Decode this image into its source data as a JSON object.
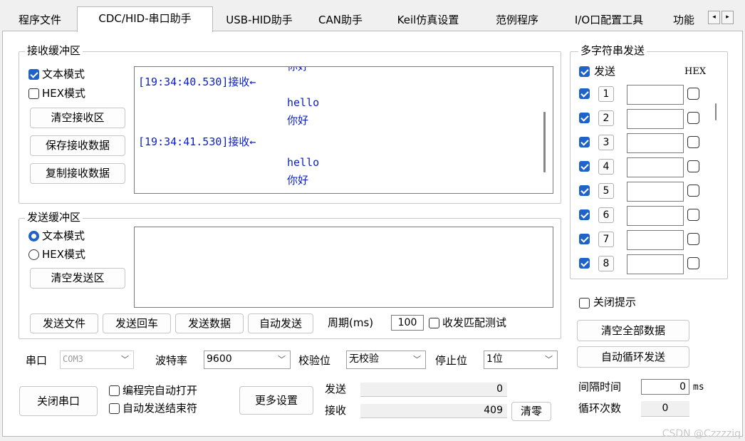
{
  "tabs": [
    {
      "label": "程序文件"
    },
    {
      "label": "CDC/HID-串口助手",
      "active": true
    },
    {
      "label": "USB-HID助手"
    },
    {
      "label": "CAN助手"
    },
    {
      "label": "Keil仿真设置"
    },
    {
      "label": "范例程序"
    },
    {
      "label": "I/O口配置工具"
    },
    {
      "label": "功能"
    }
  ],
  "tab_scroll": {
    "left": "◂",
    "right": "▸"
  },
  "receive": {
    "legend": "接收缓冲区",
    "text_mode": {
      "label": "文本模式",
      "checked": true
    },
    "hex_mode": {
      "label": "HEX模式",
      "checked": false
    },
    "clear_label": "清空接收区",
    "save_label": "保存接收数据",
    "copy_label": "复制接收数据",
    "lines": [
      {
        "text": "你好",
        "indent": 2
      },
      {
        "text": "[19:34:40.530]接收←",
        "indent": 0
      },
      {
        "text": "hello",
        "indent": 2
      },
      {
        "text": "你好",
        "indent": 2
      },
      {
        "text": "[19:34:41.530]接收←",
        "indent": 0
      },
      {
        "text": "hello",
        "indent": 2
      },
      {
        "text": "你好",
        "indent": 2
      }
    ]
  },
  "send": {
    "legend": "发送缓冲区",
    "text_mode": {
      "label": "文本模式",
      "selected": true
    },
    "hex_mode": {
      "label": "HEX模式",
      "selected": false
    },
    "clear_label": "清空发送区",
    "send_file_label": "发送文件",
    "send_enter_label": "发送回车",
    "send_data_label": "发送数据",
    "auto_send_label": "自动发送",
    "period_label": "周期(ms)",
    "period_value": "100",
    "match_test_label": "收发匹配测试"
  },
  "port": {
    "port_label": "串口",
    "port_value": "COM3",
    "baud_label": "波特率",
    "baud_value": "9600",
    "parity_label": "校验位",
    "parity_value": "无校验",
    "stop_label": "停止位",
    "stop_value": "1位",
    "close_label": "关闭串口",
    "auto_open_label": "编程完自动打开",
    "auto_end_label": "自动发送结束符",
    "more_label": "更多设置",
    "tx_label": "发送",
    "tx_count": "0",
    "rx_label": "接收",
    "rx_count": "409",
    "reset_label": "清零"
  },
  "multi": {
    "legend": "多字符串发送",
    "send_label": "发送",
    "send_checked": true,
    "hex_label": "HEX",
    "rows": [
      {
        "num": "1",
        "checked": true,
        "value": ""
      },
      {
        "num": "2",
        "checked": true,
        "value": ""
      },
      {
        "num": "3",
        "checked": true,
        "value": ""
      },
      {
        "num": "4",
        "checked": true,
        "value": ""
      },
      {
        "num": "5",
        "checked": true,
        "value": ""
      },
      {
        "num": "6",
        "checked": true,
        "value": ""
      },
      {
        "num": "7",
        "checked": true,
        "value": ""
      },
      {
        "num": "8",
        "checked": true,
        "value": ""
      }
    ],
    "close_hint_label": "关闭提示",
    "clear_all_label": "清空全部数据",
    "auto_loop_label": "自动循环发送",
    "interval_label": "间隔时间",
    "interval_value": "0",
    "interval_unit": "ms",
    "loop_label": "循环次数",
    "loop_value": "0"
  },
  "watermark": "CSDN @Czzzziq",
  "colors": {
    "accent": "#1f63c8",
    "rx_text": "#0a1ec8"
  }
}
